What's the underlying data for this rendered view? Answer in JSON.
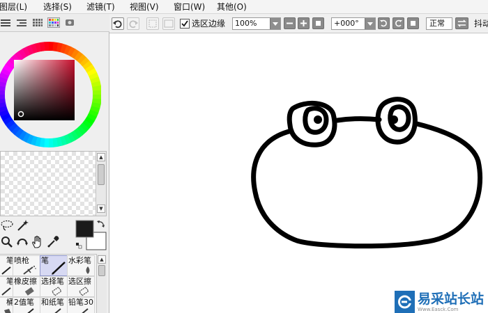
{
  "menu": {
    "items": [
      {
        "label": "图层(L)"
      },
      {
        "label": "选择(S)"
      },
      {
        "label": "滤镜(T)"
      },
      {
        "label": "视图(V)"
      },
      {
        "label": "窗口(W)"
      },
      {
        "label": "其他(O)"
      }
    ]
  },
  "toolbar": {
    "selection_edge_checkbox": {
      "label": "选区边缘",
      "checked": true
    },
    "zoom": {
      "value": "100%"
    },
    "rotation": {
      "value": "+000°"
    },
    "blend_mode": {
      "label": "正常"
    },
    "antialias_label": "抖动"
  },
  "color": {
    "primary": "#1a1a1a",
    "secondary": "#ffffff",
    "wheel_hue": "#c8102e"
  },
  "brushes": {
    "cells": [
      {
        "label": "笔",
        "active": false
      },
      {
        "label": "喷枪",
        "active": false
      },
      {
        "label": "笔",
        "active": true
      },
      {
        "label": "水彩笔",
        "active": false
      },
      {
        "label": "笔",
        "active": false
      },
      {
        "label": "橡皮擦",
        "active": false
      },
      {
        "label": "选择笔",
        "active": false
      },
      {
        "label": "选区擦",
        "active": false
      },
      {
        "label": "桶",
        "active": false
      },
      {
        "label": "2值笔",
        "active": false
      },
      {
        "label": "和纸笔",
        "active": false
      },
      {
        "label": "铅笔30",
        "active": false
      }
    ]
  },
  "watermark": {
    "brand": "易采站长站",
    "url": "Www.Easck.Com"
  }
}
